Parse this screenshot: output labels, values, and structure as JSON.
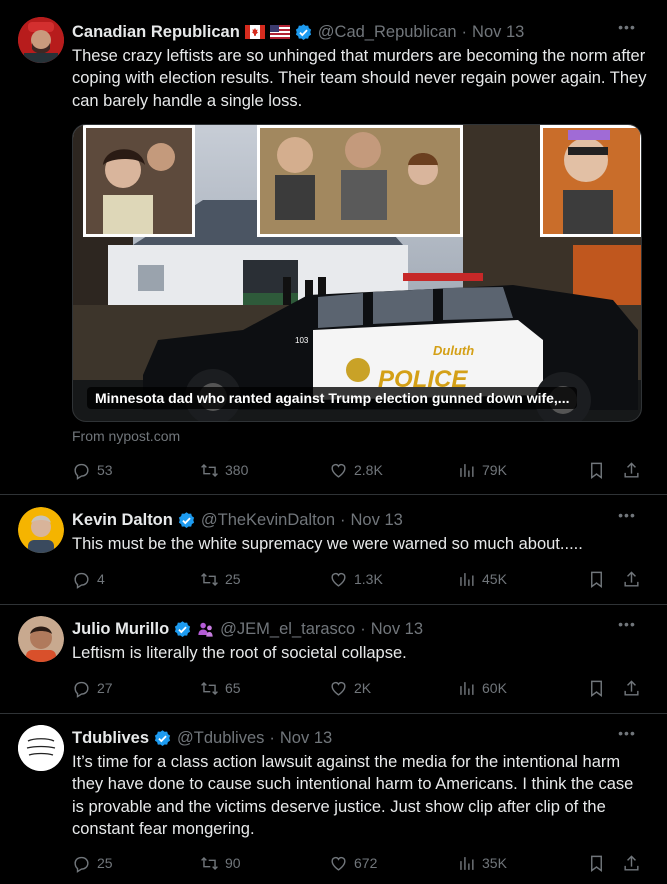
{
  "tweets": [
    {
      "name": "Canadian Republican",
      "handle": "@Cad_Republican",
      "date": "Nov 13",
      "text": "These crazy leftists are so unhinged that murders are becoming the norm after coping with election results. Their team should never regain power again. They can barely handle a single loss.",
      "media": {
        "caption": "Minnesota dad who ranted against Trump election gunned down wife,...",
        "source": "From nypost.com",
        "car_lettering": "POLICE",
        "car_city": "Duluth",
        "car_number": "103"
      },
      "stats": {
        "replies": "53",
        "reposts": "380",
        "likes": "2.8K",
        "views": "79K"
      }
    },
    {
      "name": "Kevin Dalton",
      "handle": "@TheKevinDalton",
      "date": "Nov 13",
      "text": "This must be the white supremacy we were warned so much about.....",
      "stats": {
        "replies": "4",
        "reposts": "25",
        "likes": "1.3K",
        "views": "45K"
      }
    },
    {
      "name": "Julio Murillo",
      "handle": "@JEM_el_tarasco",
      "date": "Nov 13",
      "text": "Leftism is literally the root of societal collapse.",
      "stats": {
        "replies": "27",
        "reposts": "65",
        "likes": "2K",
        "views": "60K"
      }
    },
    {
      "name": "Tdublives",
      "handle": "@Tdublives",
      "date": "Nov 13",
      "text": "It’s time for a class action lawsuit against the media for the intentional harm they have done to cause such intentional harm to Americans. I think the case is provable and the victims deserve justice. Just show clip after clip of the constant fear mongering.",
      "stats": {
        "replies": "25",
        "reposts": "90",
        "likes": "672",
        "views": "35K"
      }
    }
  ],
  "colors": {
    "background": "#000000",
    "text": "#e7e9ea",
    "muted": "#71767b",
    "verified": "#1d9bf0",
    "divider": "#2f3336"
  },
  "icons": [
    "reply-icon",
    "repost-icon",
    "like-icon",
    "views-icon",
    "bookmark-icon",
    "share-icon",
    "more-icon",
    "verified-badge-icon"
  ]
}
